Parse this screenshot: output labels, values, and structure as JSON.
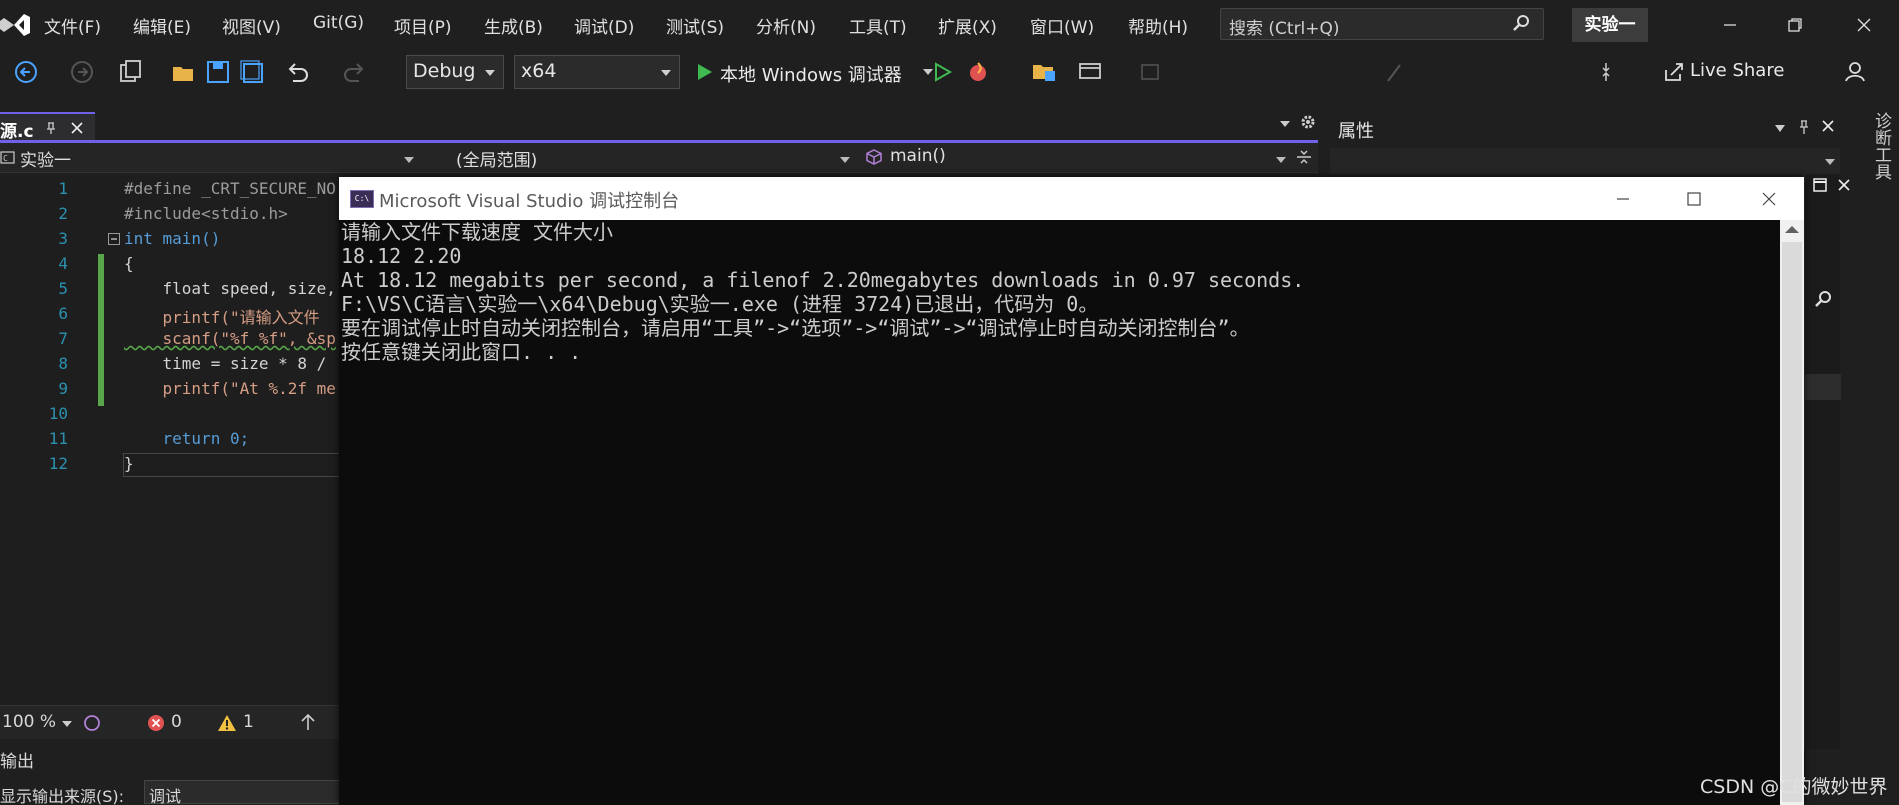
{
  "menubar": {
    "items": [
      "文件(F)",
      "编辑(E)",
      "视图(V)",
      "Git(G)",
      "项目(P)",
      "生成(B)",
      "调试(D)",
      "测试(S)",
      "分析(N)",
      "工具(T)",
      "扩展(X)",
      "窗口(W)",
      "帮助(H)"
    ],
    "search_placeholder": "搜索 (Ctrl+Q)",
    "project_name": "实验一"
  },
  "toolbar": {
    "config": "Debug",
    "platform": "x64",
    "run_label": "本地 Windows 调试器",
    "live_share": "Live Share"
  },
  "editor": {
    "tab_name": "源.c",
    "nav_project": "实验一",
    "nav_scope": "(全局范围)",
    "nav_member": "main()",
    "line_numbers": [
      "1",
      "2",
      "3",
      "4",
      "5",
      "6",
      "7",
      "8",
      "9",
      "10",
      "11",
      "12"
    ],
    "lines": [
      "#define _CRT_SECURE_NO",
      "#include<stdio.h>",
      "int main()",
      "{",
      "    float speed, size,",
      "    printf(\"请输入文件",
      "    scanf(\"%f %f\", &sp",
      "    time = size * 8 /",
      "    printf(\"At %.2f me",
      "",
      "    return 0;",
      "}"
    ],
    "zoom": "100 %",
    "errors": "0",
    "warnings": "1"
  },
  "output": {
    "title": "输出",
    "source_label": "显示输出来源(S):",
    "source_value": "调试"
  },
  "properties": {
    "title": "属性",
    "side_tab": "诊断工具"
  },
  "console": {
    "title": "Microsoft Visual Studio 调试控制台",
    "lines": [
      "请输入文件下载速度 文件大小",
      "18.12 2.20",
      "At 18.12 megabits per second, a filenof 2.20megabytes downloads in 0.97 seconds.",
      "F:\\VS\\C语言\\实验一\\x64\\Debug\\实验一.exe (进程 3724)已退出，代码为 0。",
      "要在调试停止时自动关闭控制台，请启用“工具”->“选项”->“调试”->“调试停止时自动关闭控制台”。",
      "按任意键关闭此窗口. . ."
    ]
  },
  "watermark": "CSDN @C的微妙世界",
  "colors": {
    "accent": "#7160e8",
    "run_green": "#3fb950",
    "error_red": "#e05252",
    "warning_yellow": "#f0c040"
  }
}
